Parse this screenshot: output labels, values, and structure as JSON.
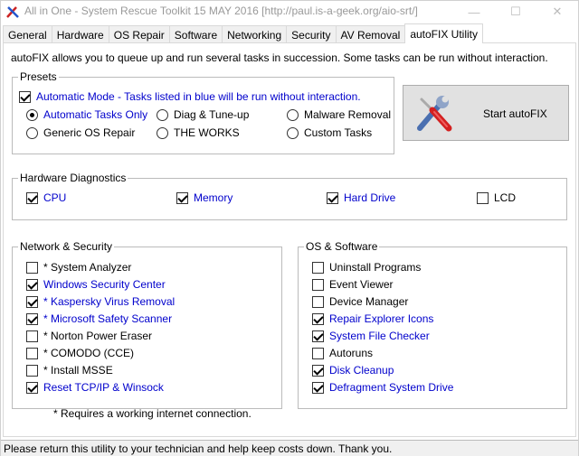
{
  "window": {
    "title": "All in One - System Rescue Toolkit 15 MAY 2016 [http://paul.is-a-geek.org/aio-srt/]"
  },
  "tabs": [
    {
      "label": "General"
    },
    {
      "label": "Hardware"
    },
    {
      "label": "OS Repair"
    },
    {
      "label": "Software"
    },
    {
      "label": "Networking"
    },
    {
      "label": "Security"
    },
    {
      "label": "AV Removal"
    },
    {
      "label": "autoFIX Utility",
      "active": true
    }
  ],
  "intro": "autoFIX allows you to queue up and run several tasks in succession.  Some tasks can be run without interaction.",
  "presets": {
    "legend": "Presets",
    "automatic_mode": {
      "label": "Automatic Mode - Tasks listed in blue will be run without interaction.",
      "checked": true
    },
    "radios": [
      {
        "label": "Automatic Tasks Only",
        "checked": true
      },
      {
        "label": "Diag & Tune-up",
        "checked": false
      },
      {
        "label": "Malware Removal",
        "checked": false
      },
      {
        "label": "Generic OS Repair",
        "checked": false
      },
      {
        "label": "THE WORKS",
        "checked": false
      },
      {
        "label": "Custom Tasks",
        "checked": false
      }
    ]
  },
  "start_button": {
    "label": "Start autoFIX",
    "icon": "tools-icon"
  },
  "hardware": {
    "legend": "Hardware Diagnostics",
    "items": [
      {
        "label": "CPU",
        "checked": true,
        "auto": true
      },
      {
        "label": "Memory",
        "checked": true,
        "auto": true
      },
      {
        "label": "Hard Drive",
        "checked": true,
        "auto": true
      },
      {
        "label": "LCD",
        "checked": false,
        "auto": false
      }
    ]
  },
  "network": {
    "legend": "Network & Security",
    "items": [
      {
        "label": "* System Analyzer",
        "checked": false,
        "auto": false
      },
      {
        "label": "Windows Security Center",
        "checked": true,
        "auto": true
      },
      {
        "label": "* Kaspersky Virus Removal",
        "checked": true,
        "auto": true
      },
      {
        "label": "* Microsoft Safety Scanner",
        "checked": true,
        "auto": true
      },
      {
        "label": "* Norton Power Eraser",
        "checked": false,
        "auto": false
      },
      {
        "label": "* COMODO (CCE)",
        "checked": false,
        "auto": false
      },
      {
        "label": "* Install MSSE",
        "checked": false,
        "auto": false
      },
      {
        "label": "Reset TCP/IP & Winsock",
        "checked": true,
        "auto": true
      }
    ]
  },
  "os": {
    "legend": "OS & Software",
    "items": [
      {
        "label": "Uninstall Programs",
        "checked": false,
        "auto": false
      },
      {
        "label": "Event Viewer",
        "checked": false,
        "auto": false
      },
      {
        "label": "Device Manager",
        "checked": false,
        "auto": false
      },
      {
        "label": "Repair Explorer Icons",
        "checked": true,
        "auto": true
      },
      {
        "label": "System File Checker",
        "checked": true,
        "auto": true
      },
      {
        "label": "Autoruns",
        "checked": false,
        "auto": false
      },
      {
        "label": "Disk Cleanup",
        "checked": true,
        "auto": true
      },
      {
        "label": "Defragment System Drive",
        "checked": true,
        "auto": true
      }
    ]
  },
  "footnote": "* Requires a working internet connection.",
  "status": "Please return this utility to your technician and help keep costs down. Thank you.",
  "colors": {
    "auto_task": "#0000cc"
  }
}
